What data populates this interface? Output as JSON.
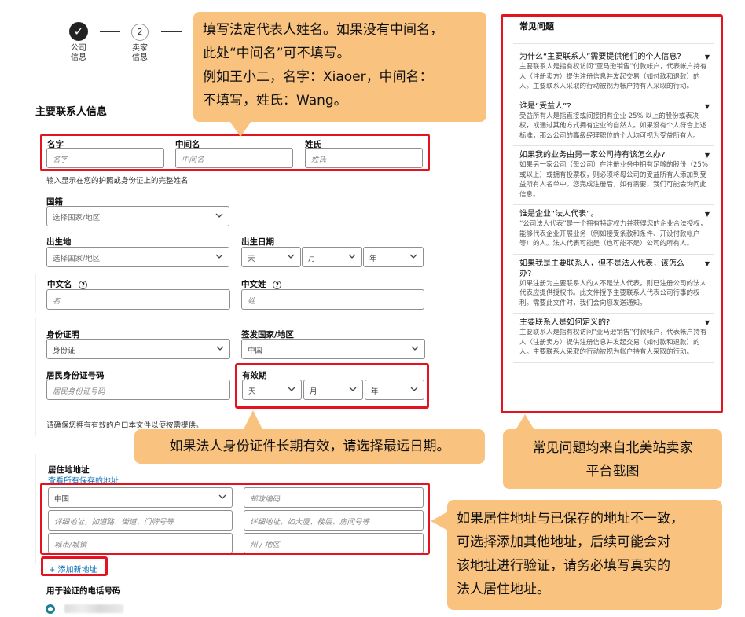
{
  "stepper": {
    "step1": {
      "icon": "check-icon",
      "label_line1": "公司",
      "label_line2": "信息"
    },
    "step2": {
      "number": "2",
      "label_line1": "卖家",
      "label_line2": "信息"
    }
  },
  "section_title": "主要联系人信息",
  "name": {
    "first_label": "名字",
    "first_placeholder": "名字",
    "middle_label": "中间名",
    "middle_placeholder": "中间名",
    "last_label": "姓氏",
    "last_placeholder": "姓氏",
    "hint": "输入显示在您的护照或身份证上的完整姓名"
  },
  "nationality": {
    "label": "国籍",
    "value": "选择国家/地区"
  },
  "birthplace": {
    "label": "出生地",
    "value": "选择国家/地区"
  },
  "birthdate": {
    "label": "出生日期",
    "day": "天",
    "month": "月",
    "year": "年"
  },
  "chinese_first": {
    "label": "中文名",
    "placeholder": "名"
  },
  "chinese_last": {
    "label": "中文姓",
    "placeholder": "姓"
  },
  "id_proof": {
    "label": "身份证明",
    "value": "身份证"
  },
  "issuing_country": {
    "label": "签发国家/地区",
    "value": "中国"
  },
  "id_number": {
    "label": "居民身份证号码",
    "placeholder": "居民身份证号码"
  },
  "expiry": {
    "label": "有效期",
    "day": "天",
    "month": "月",
    "year": "年"
  },
  "household_hint": "请确保您拥有有效的户口本文件以便按需提供。",
  "address": {
    "label": "居住地地址",
    "saved_link": "查看所有保存的地址",
    "country": "中国",
    "postcode_placeholder": "邮政编码",
    "line1_placeholder": "详细地址，如道路、街道、门牌号等",
    "line2_placeholder": "详细地址，如大厦、楼层、房间号等",
    "city_placeholder": "城市/城镇",
    "state_placeholder": "州 / 地区",
    "add_new": "+ 添加新地址"
  },
  "phone": {
    "label": "用于验证的电话号码"
  },
  "faq": {
    "title": "常见问题",
    "items": [
      {
        "q": "为什么“主要联系人”需要提供他们的个人信息?",
        "a": "主要联系人是指有权访问“亚马逊销售”付款帐户，代表帐户持有人（注册卖方）提供注册信息并发起交易（如付款和退款）的人。主要联系人采取的行动被视为帐户持有人采取的行动。"
      },
      {
        "q": "谁是“受益人”?",
        "a": "受益所有人是指直接或间接拥有企业 25% 以上的股份或表决权，或通过其他方式拥有企业的自然人。如果没有个人符合上述标准，那么公司的高级经理职位的个人均可视为受益所有人。"
      },
      {
        "q": "如果我的业务由另一家公司持有该怎么办?",
        "a": "如果另一家公司（母公司）在注册业务中拥有足够的股份（25%或以上）或拥有投票权，则必须将母公司的受益所有人添加到受益所有人名单中。您完成注册后，如有需要，我们可能会询问此信息。"
      },
      {
        "q": "谁是企业“法人代表”。",
        "a": "“公司法人代表”是一个拥有特定权力并获得您的企业合法授权，能够代表企业开展业务（例如接受条款和条件、开设付款帐户等）的人。法人代表可能是（也可能不是）公司的所有人。"
      },
      {
        "q": "如果我是主要联系人，但不是法人代表，该怎么办?",
        "a": "如果注册为主要联系人的人不是法人代表，则已注册公司的法人代表应提供授权书。此文件授予主要联系人代表公司行事的权利。需要此文件时，我们会向您发送通知。"
      },
      {
        "q": "主要联系人是如何定义的?",
        "a": "主要联系人是指有权访问“亚马逊销售”付款帐户，代表帐户持有人（注册卖方）提供注册信息并发起交易（如付款和退款）的人。主要联系人采取的行动被视为帐户持有人采取的行动。"
      }
    ]
  },
  "callouts": {
    "name_lines": [
      "填写法定代表人姓名。如果没有中间名，",
      "此处“中间名”可不填写。",
      "例如王小二，名字：Xiaoer，中间名：",
      "不填写，姓氏：Wang。"
    ],
    "expiry": "如果法人身份证件长期有效，请选择最远日期。",
    "faq_lines": [
      "常见问题均来自北美站卖家",
      "平台截图"
    ],
    "address_lines": [
      "如果居住地址与已保存的地址不一致，",
      "可选择添加其他地址，后续可能会对",
      "该地址进行验证，请务必填写真实的",
      "法人居住地址。"
    ]
  },
  "colors": {
    "red_box": "#e3141f",
    "callout_bg": "#f9c37f",
    "link": "#0a6fb8"
  }
}
